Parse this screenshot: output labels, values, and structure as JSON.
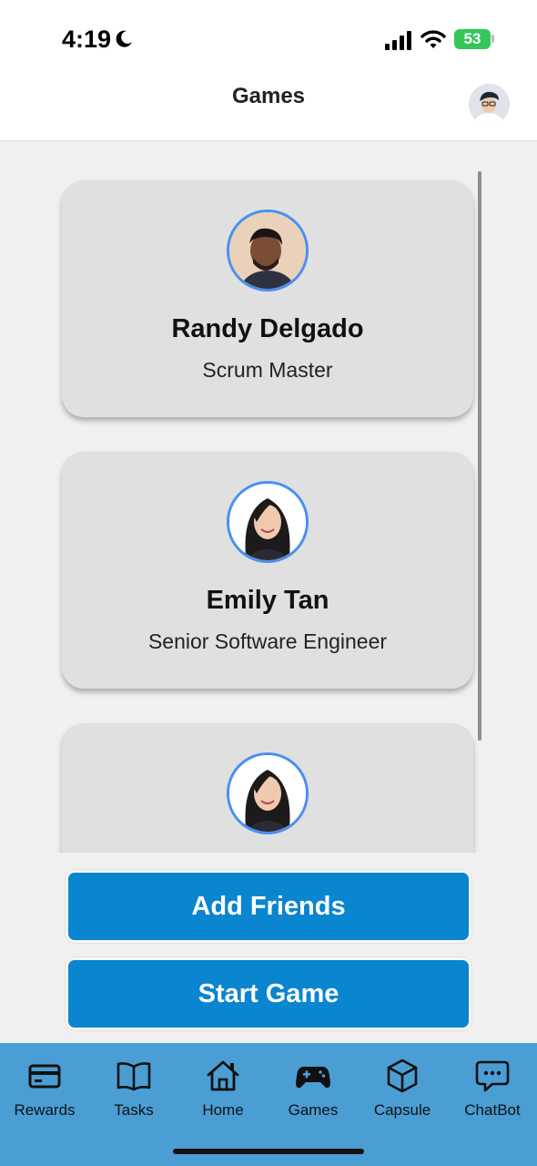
{
  "status_bar": {
    "time": "4:19",
    "battery": "53"
  },
  "header": {
    "title": "Games"
  },
  "cards": [
    {
      "name": "Randy Delgado",
      "role": "Scrum Master"
    },
    {
      "name": "Emily Tan",
      "role": "Senior Software Engineer"
    },
    {
      "name": "",
      "role": ""
    }
  ],
  "actions": {
    "add_friends": "Add Friends",
    "start_game": "Start Game"
  },
  "nav": {
    "items": [
      {
        "label": "Rewards",
        "icon": "card-icon"
      },
      {
        "label": "Tasks",
        "icon": "book-icon"
      },
      {
        "label": "Home",
        "icon": "home-icon"
      },
      {
        "label": "Games",
        "icon": "gamepad-icon"
      },
      {
        "label": "Capsule",
        "icon": "cube-icon"
      },
      {
        "label": "ChatBot",
        "icon": "chat-icon"
      }
    ]
  },
  "colors": {
    "accent": "#0a85cf",
    "nav_background": "#4a9ed4",
    "avatar_ring": "#4a8ff0"
  }
}
